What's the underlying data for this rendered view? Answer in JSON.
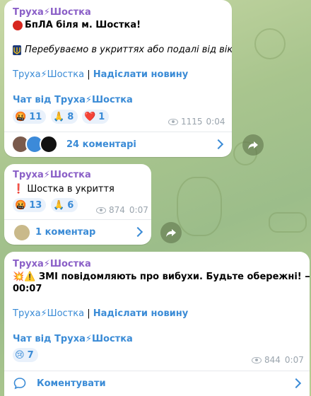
{
  "channel": {
    "name": "Труха⚡Шостка"
  },
  "posts": [
    {
      "sender": "Труха⚡Шостка",
      "headline": "БпЛА біля м. Шостка!",
      "note": "Перебуваємо в укриттях або подалі від вікон!",
      "link_channel": "Труха⚡Шостка",
      "link_separator": "|",
      "link_submit": "Надіслати новину",
      "chat_link": "Чат від Труха⚡Шостка",
      "reactions": [
        {
          "emoji": "🤬",
          "count": "11"
        },
        {
          "emoji": "🙏",
          "count": "8"
        },
        {
          "emoji": "❤️",
          "count": "1"
        }
      ],
      "views": "1115",
      "time": "0:04",
      "comments_label": "24 коментарі"
    },
    {
      "sender": "Труха⚡Шостка",
      "headline_icon": "❗",
      "headline": "Шостка в укриття",
      "reactions": [
        {
          "emoji": "🤬",
          "count": "13"
        },
        {
          "emoji": "🙏",
          "count": "6"
        }
      ],
      "views": "874",
      "time": "0:07",
      "comments_label": "1 коментар"
    },
    {
      "sender": "Труха⚡Шостка",
      "headline_icons": "💥⚠️",
      "headline": "ЗМІ повідомляють про вибухи. Будьте обережні! —",
      "headline_clock": "🕰️",
      "headline_time": "00:07",
      "link_channel": "Труха⚡Шостка",
      "link_separator": "|",
      "link_submit": "Надіслати новину",
      "chat_link": "Чат від Труха⚡Шостка",
      "reactions": [
        {
          "emoji": "😢",
          "count": "7"
        }
      ],
      "views": "844",
      "time": "0:07",
      "comments_label": "Коментувати"
    }
  ]
}
